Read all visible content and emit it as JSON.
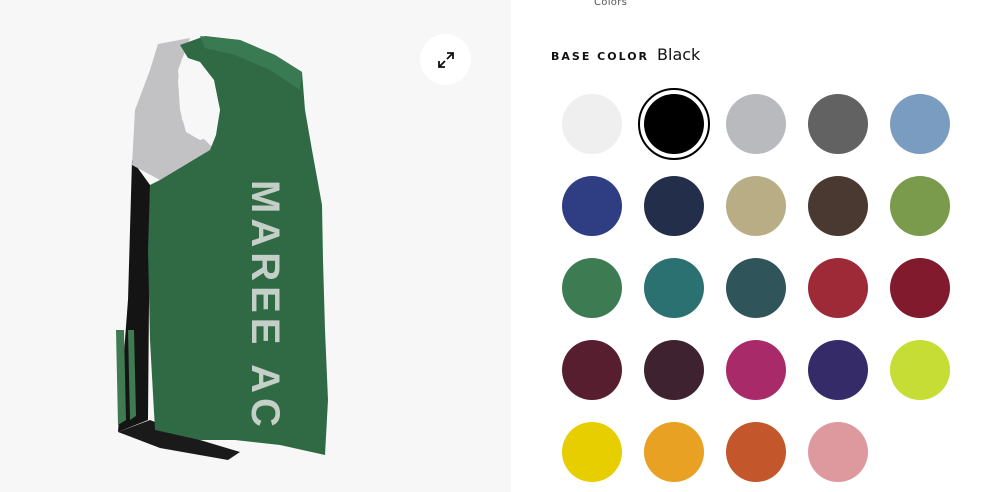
{
  "preview": {
    "jersey_text": "MAREE AC",
    "expand_icon": "expand-arrows-icon"
  },
  "panel": {
    "tab_label": "Colors",
    "base_color_title": "BASE COLOR",
    "base_color_value": "Black",
    "selected_index": 1,
    "swatches": [
      {
        "name": "White",
        "color": "#efefef"
      },
      {
        "name": "Black",
        "color": "#000000"
      },
      {
        "name": "Silver",
        "color": "#b9babe"
      },
      {
        "name": "Charcoal",
        "color": "#626263"
      },
      {
        "name": "Light Blue",
        "color": "#7b9cc1"
      },
      {
        "name": "Royal",
        "color": "#2f3e83"
      },
      {
        "name": "Navy",
        "color": "#232f4a"
      },
      {
        "name": "Vegas Gold",
        "color": "#b8ad85"
      },
      {
        "name": "Brown",
        "color": "#4a3931"
      },
      {
        "name": "Olive",
        "color": "#799b4b"
      },
      {
        "name": "Kelly Green",
        "color": "#3d7b53"
      },
      {
        "name": "Teal",
        "color": "#2c7172"
      },
      {
        "name": "Slate",
        "color": "#2f555b"
      },
      {
        "name": "Red",
        "color": "#9e2937"
      },
      {
        "name": "Cardinal",
        "color": "#821a2e"
      },
      {
        "name": "Maroon",
        "color": "#571e2f"
      },
      {
        "name": "Eggplant",
        "color": "#3e2230"
      },
      {
        "name": "Magenta",
        "color": "#a92a69"
      },
      {
        "name": "Purple",
        "color": "#342b68"
      },
      {
        "name": "Lime",
        "color": "#c6dd35"
      },
      {
        "name": "Yellow",
        "color": "#e6ce00"
      },
      {
        "name": "Gold",
        "color": "#e8a123"
      },
      {
        "name": "Orange",
        "color": "#c4562c"
      },
      {
        "name": "Pink",
        "color": "#de999e"
      }
    ]
  }
}
